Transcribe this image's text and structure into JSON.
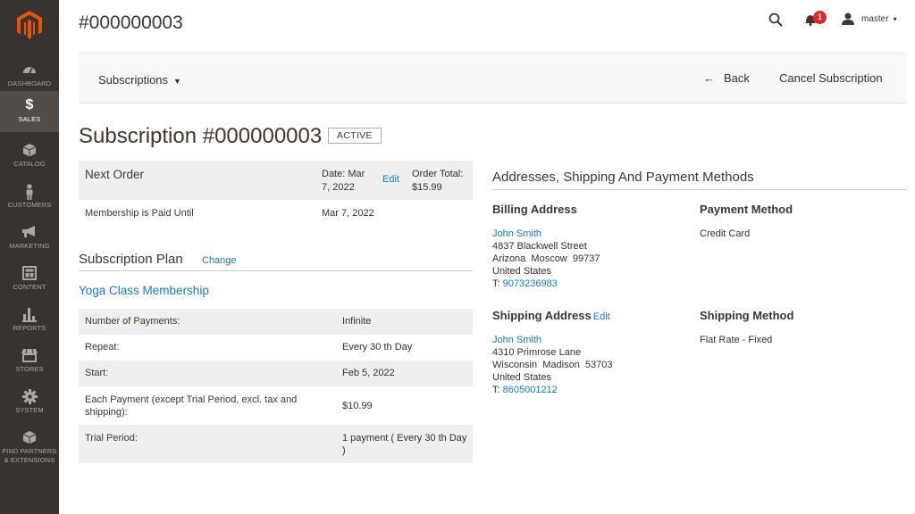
{
  "header": {
    "page_id": "#000000003",
    "notification_count": "1",
    "user_name": "master"
  },
  "sidebar": {
    "items": [
      {
        "label": "Dashboard",
        "icon": "dashboard-icon"
      },
      {
        "label": "Sales",
        "icon": "dollar-icon"
      },
      {
        "label": "Catalog",
        "icon": "box-icon"
      },
      {
        "label": "Customers",
        "icon": "person-icon"
      },
      {
        "label": "Marketing",
        "icon": "megaphone-icon"
      },
      {
        "label": "Content",
        "icon": "layout-icon"
      },
      {
        "label": "Reports",
        "icon": "bar-chart-icon"
      },
      {
        "label": "Stores",
        "icon": "storefront-icon"
      },
      {
        "label": "System",
        "icon": "gear-icon"
      },
      {
        "label": "Find Partners",
        "label2": "& Extensions",
        "icon": "partners-box-icon"
      }
    ],
    "active_index": 1
  },
  "toolbar": {
    "dropdown_label": "Subscriptions",
    "back_label": "Back",
    "cancel_label": "Cancel Subscription"
  },
  "subscription": {
    "title": "Subscription #000000003",
    "status": "ACTIVE"
  },
  "next_order": {
    "title": "Next Order",
    "date_text": "Date: Mar 7, 2022",
    "edit_label": "Edit",
    "total_text": "Order Total: $15.99",
    "paid_until_label": "Membership is Paid Until",
    "paid_until_value": "Mar 7, 2022"
  },
  "plan": {
    "section_title": "Subscription Plan",
    "change_label": "Change",
    "name": "Yoga Class Membership",
    "rows": [
      {
        "label": "Number of Payments:",
        "value": "Infinite"
      },
      {
        "label": "Repeat:",
        "value": "Every 30 th Day"
      },
      {
        "label": "Start:",
        "value": "Feb 5, 2022"
      },
      {
        "label": "Each Payment (except Trial Period, excl. tax and shipping):",
        "value": "$10.99"
      },
      {
        "label": "Trial Period:",
        "value": "1 payment ( Every 30 th Day )"
      }
    ]
  },
  "addresses": {
    "title": "Addresses, Shipping And Payment Methods",
    "billing": {
      "heading": "Billing Address",
      "name": "John Smith",
      "street": "4837 Blackwell Street",
      "city_line": "Arizona  Moscow  99737",
      "country": "United States",
      "phone_prefix": "T: ",
      "phone": "9073236983"
    },
    "payment": {
      "heading": "Payment Method",
      "value": "Credit Card"
    },
    "shipping": {
      "heading": "Shipping Address",
      "edit_label": "Edit",
      "name": "John Smith",
      "street": "4310 Primrose Lane",
      "city_line": "Wisconsin  Madison  53703",
      "country": "United States",
      "phone_prefix": "T: ",
      "phone": "8605001212"
    },
    "shipping_method": {
      "heading": "Shipping Method",
      "value": "Flat Rate - Fixed"
    }
  },
  "colors": {
    "sidebar_bg": "#373330",
    "sidebar_active": "#524d49",
    "link": "#1979c3",
    "logo": "#eb5202",
    "badge": "#e22626"
  }
}
